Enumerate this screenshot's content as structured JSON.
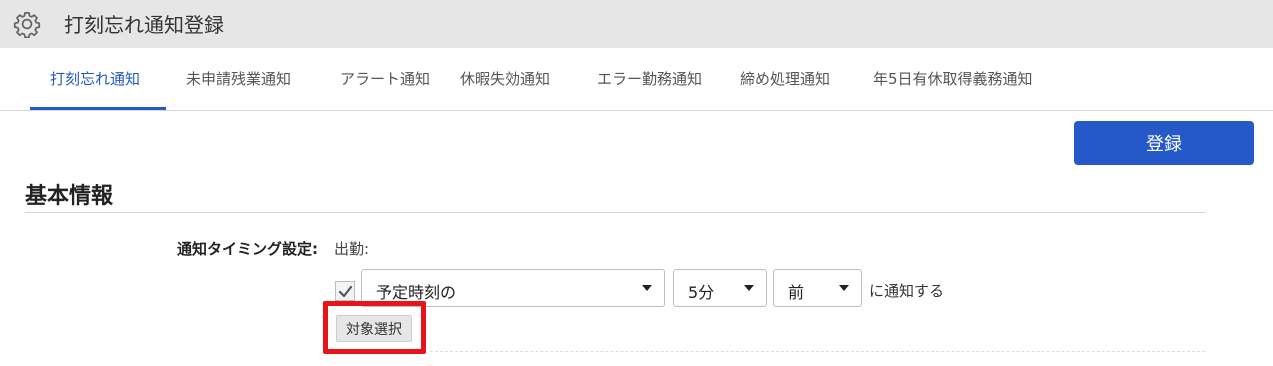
{
  "app": {
    "title": "打刻忘れ通知登録",
    "icon": "gear-icon"
  },
  "tabs": [
    {
      "label": "打刻忘れ通知",
      "active": true
    },
    {
      "label": "未申請残業通知",
      "active": false
    },
    {
      "label": "アラート通知",
      "active": false
    },
    {
      "label": "休暇失効通知",
      "active": false
    },
    {
      "label": "エラー勤務通知",
      "active": false
    },
    {
      "label": "締め処理通知",
      "active": false
    },
    {
      "label": "年5日有休取得義務通知",
      "active": false
    }
  ],
  "toolbar": {
    "register_label": "登録"
  },
  "section": {
    "title": "基本情報"
  },
  "form": {
    "timing_label": "通知タイミング設定:",
    "timing_value": "出勤:",
    "checkbox_checked": true,
    "select_timing": "予定時刻の",
    "select_minutes": "5分",
    "select_direction": "前",
    "suffix": "に通知する",
    "target_button": "対象選択"
  },
  "colors": {
    "accent": "#2359c4",
    "button": "#2559c9",
    "highlight": "#e8141b",
    "titlebar": "#e6e6e6"
  }
}
